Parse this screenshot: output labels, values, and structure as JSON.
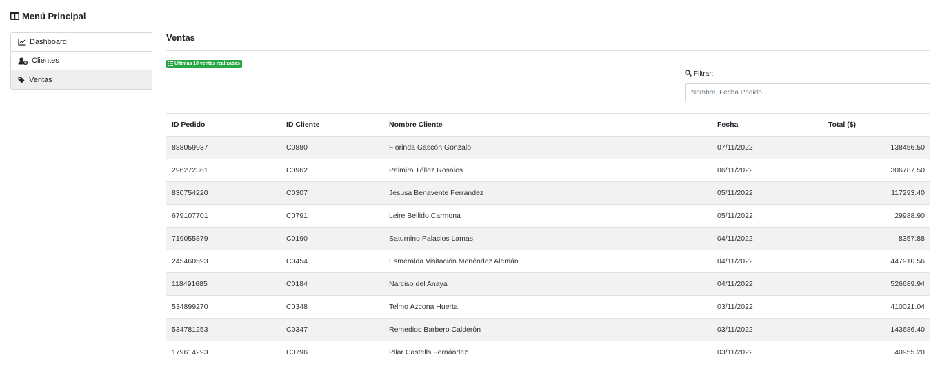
{
  "sidebar": {
    "title": "Menú Principal",
    "items": [
      {
        "label": "Dashboard",
        "icon": "chart-line-icon",
        "active": false
      },
      {
        "label": "Clientes",
        "icon": "users-cog-icon",
        "active": false
      },
      {
        "label": "Ventas",
        "icon": "tag-icon",
        "active": true
      }
    ]
  },
  "main": {
    "title": "Ventas",
    "badge": "Ultimas 10 ventas realizadas",
    "filter": {
      "label": "Filtrar:",
      "placeholder": "Nombre, Fecha Pedido..."
    },
    "table": {
      "headers": [
        "ID Pedido",
        "ID Cliente",
        "Nombre Cliente",
        "Fecha",
        "Total ($)"
      ],
      "rows": [
        [
          "888059937",
          "C0880",
          "Florinda Gascón Gonzalo",
          "07/11/2022",
          "138456.50"
        ],
        [
          "296272361",
          "C0962",
          "Palmira Téllez Rosales",
          "06/11/2022",
          "306787.50"
        ],
        [
          "830754220",
          "C0307",
          "Jesusa Benavente Ferrández",
          "05/11/2022",
          "117293.40"
        ],
        [
          "679107701",
          "C0791",
          "Leire Bellido Carmona",
          "05/11/2022",
          "29988.90"
        ],
        [
          "719055879",
          "C0190",
          "Saturnino Palacios Lamas",
          "04/11/2022",
          "8357.88"
        ],
        [
          "245460593",
          "C0454",
          "Esmeralda Visitación Menéndez Alemán",
          "04/11/2022",
          "447910.56"
        ],
        [
          "118491685",
          "C0184",
          "Narciso del Anaya",
          "04/11/2022",
          "526689.94"
        ],
        [
          "534899270",
          "C0348",
          "Telmo Azcona Huerta",
          "03/11/2022",
          "410021.04"
        ],
        [
          "534781253",
          "C0347",
          "Remedios Barbero Calderón",
          "03/11/2022",
          "143686.40"
        ],
        [
          "179614293",
          "C0796",
          "Pilar Castells Fernández",
          "03/11/2022",
          "40955.20"
        ]
      ]
    }
  },
  "colors": {
    "badge": "#28a745",
    "active_item": "#eeeeee",
    "striped_row": "#f2f2f2"
  }
}
